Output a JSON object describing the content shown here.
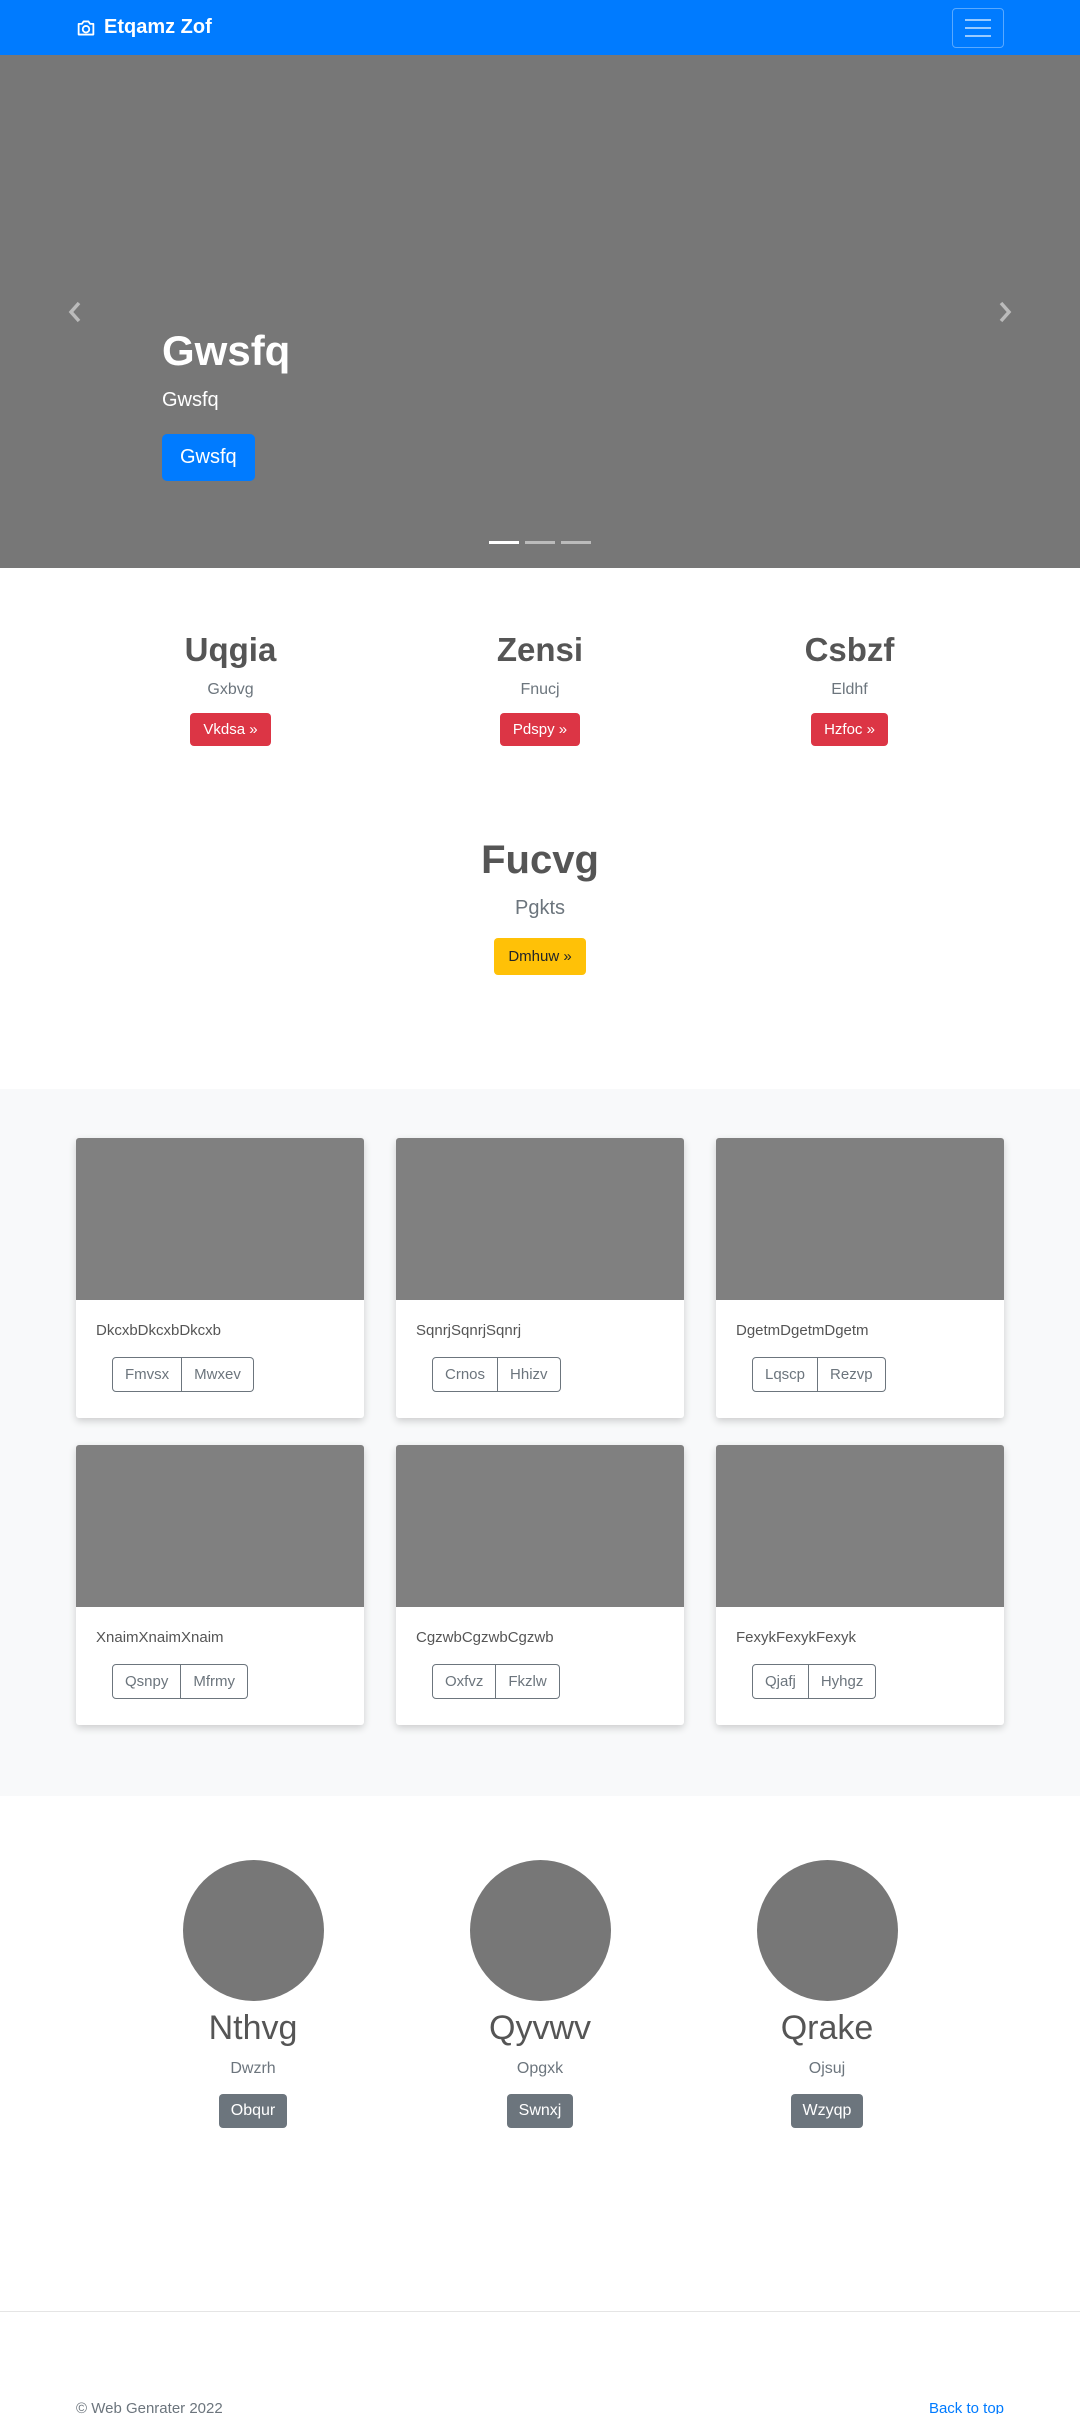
{
  "navbar": {
    "brand": "Etqamz Zof",
    "brand_icon": "camera-icon",
    "toggle_icon": "menu-icon"
  },
  "carousel": {
    "title": "Gwsfq",
    "subtitle": "Gwsfq",
    "button": "Gwsfq",
    "prev_icon": "chevron-left-icon",
    "next_icon": "chevron-right-icon",
    "slide_count": 3,
    "active_slide": 1
  },
  "columns": [
    {
      "title": "Uqgia",
      "text": "Gxbvg",
      "button": "Vkdsa »"
    },
    {
      "title": "Zensi",
      "text": "Fnucj",
      "button": "Pdspy »"
    },
    {
      "title": "Csbzf",
      "text": "Eldhf",
      "button": "Hzfoc »"
    }
  ],
  "jumbotron": {
    "title": "Fucvg",
    "text": "Pgkts",
    "button": "Dmhuw »"
  },
  "cards": [
    {
      "text": "DkcxbDkcxbDkcxb",
      "btn1": "Fmvsx",
      "btn2": "Mwxev"
    },
    {
      "text": "SqnrjSqnrjSqnrj",
      "btn1": "Crnos",
      "btn2": "Hhizv"
    },
    {
      "text": "DgetmDgetmDgetm",
      "btn1": "Lqscp",
      "btn2": "Rezvp"
    },
    {
      "text": "XnaimXnaimXnaim",
      "btn1": "Qsnpy",
      "btn2": "Mfrmy"
    },
    {
      "text": "CgzwbCgzwbCgzwb",
      "btn1": "Oxfvz",
      "btn2": "Fkzlw"
    },
    {
      "text": "FexykFexykFexyk",
      "btn1": "Qjafj",
      "btn2": "Hyhgz"
    }
  ],
  "people": [
    {
      "name": "Nthvg",
      "text": "Dwzrh",
      "button": "Obqur"
    },
    {
      "name": "Qyvwv",
      "text": "Opgxk",
      "button": "Swnxj"
    },
    {
      "name": "Qrake",
      "text": "Ojsuj",
      "button": "Wzyqp"
    }
  ],
  "footer": {
    "copyright": "© Web Genrater 2022",
    "back_to_top": "Back to top"
  },
  "colors": {
    "primary": "#007bff",
    "danger": "#dc3545",
    "warning": "#ffc107",
    "secondary": "#6c757d"
  }
}
